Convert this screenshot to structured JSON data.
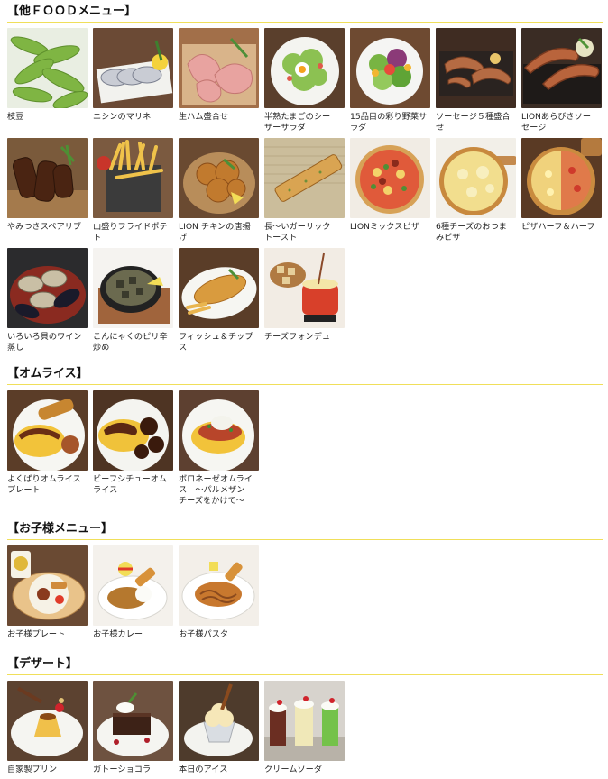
{
  "sections": [
    {
      "title": "【他ＦＯＯＤメニュー】",
      "items": [
        {
          "label": "枝豆",
          "icon": "edamame-icon"
        },
        {
          "label": "ニシンのマリネ",
          "icon": "herring-marinade-icon"
        },
        {
          "label": "生ハム盛合せ",
          "icon": "prosciutto-platter-icon"
        },
        {
          "label": "半熟たまごのシー\nザーサラダ",
          "icon": "caesar-salad-icon"
        },
        {
          "label": "15品目の彩り野菜サ\nラダ",
          "icon": "vegetable-salad-icon"
        },
        {
          "label": "ソーセージ５種盛合\nせ",
          "icon": "sausage-platter-icon"
        },
        {
          "label": "LIONあらびきソー\nセージ",
          "icon": "coarse-sausage-icon"
        },
        {
          "label": "やみつきスペアリブ",
          "icon": "spare-ribs-icon"
        },
        {
          "label": "山盛りフライドポテ\nト",
          "icon": "french-fries-icon"
        },
        {
          "label": "LION チキンの唐揚\nげ",
          "icon": "fried-chicken-icon"
        },
        {
          "label": "長～いガーリック\nトースト",
          "icon": "garlic-toast-icon"
        },
        {
          "label": "LIONミックスピザ",
          "icon": "mix-pizza-icon"
        },
        {
          "label": "6種チーズのおつま\nみピザ",
          "icon": "cheese-pizza-icon"
        },
        {
          "label": "ピザハーフ＆ハーフ",
          "icon": "half-half-pizza-icon"
        },
        {
          "label": "いろいろ貝のワイン\n蒸し",
          "icon": "shellfish-wine-icon"
        },
        {
          "label": "こんにゃくのピリ辛\n炒め",
          "icon": "konjac-stirfry-icon"
        },
        {
          "label": "フィッシュ＆チップ\nス",
          "icon": "fish-and-chips-icon"
        },
        {
          "label": "チーズフォンデュ",
          "icon": "cheese-fondue-icon"
        }
      ]
    },
    {
      "title": "【オムライス】",
      "items": [
        {
          "label": "よくばりオムライス\nプレート",
          "icon": "omurice-plate-icon"
        },
        {
          "label": "ビーフシチューオム\nライス",
          "icon": "beef-stew-omurice-icon"
        },
        {
          "label": "ボロネーゼオムライ\nス　～パルメザン\nチーズをかけて～",
          "icon": "bolognese-omurice-icon"
        }
      ]
    },
    {
      "title": "【お子様メニュー】",
      "items": [
        {
          "label": "お子様プレート",
          "icon": "kids-plate-icon"
        },
        {
          "label": "お子様カレー",
          "icon": "kids-curry-icon"
        },
        {
          "label": "お子様パスタ",
          "icon": "kids-pasta-icon"
        }
      ]
    },
    {
      "title": "【デザート】",
      "items": [
        {
          "label": "自家製プリン",
          "icon": "pudding-icon"
        },
        {
          "label": "ガトーショコラ",
          "icon": "gateau-chocolat-icon"
        },
        {
          "label": "本日のアイス",
          "icon": "ice-cream-icon"
        },
        {
          "label": "クリームソーダ",
          "icon": "cream-soda-icon"
        }
      ]
    }
  ]
}
